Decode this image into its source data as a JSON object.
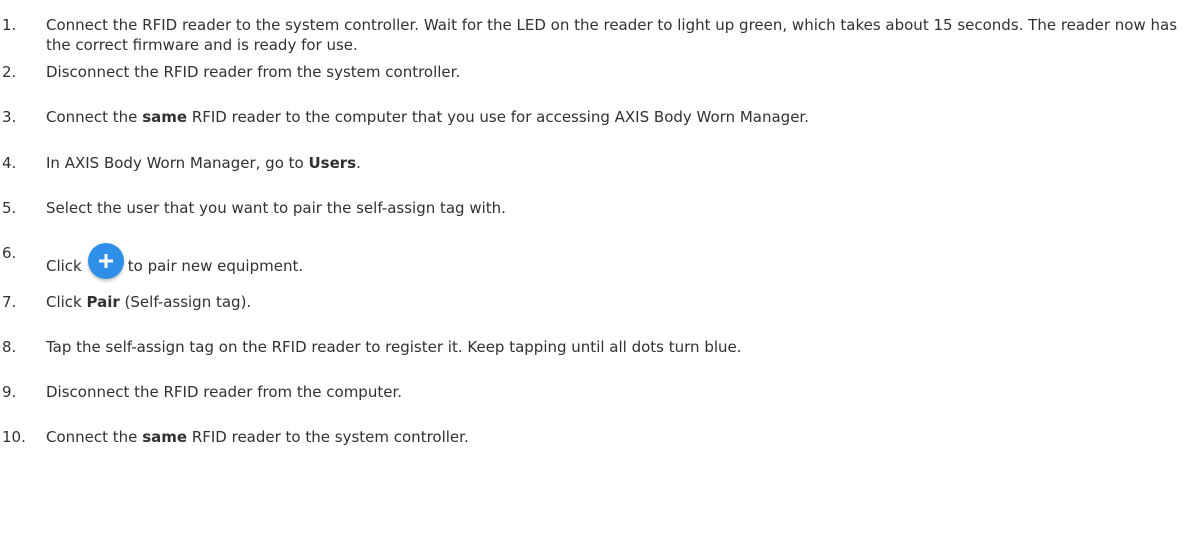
{
  "steps": [
    {
      "number": "1.",
      "parts": [
        {
          "text": "Connect the RFID reader to the system controller. Wait for the LED on the reader to light up green, which takes about 15 seconds. The reader now has the correct firmware and is ready for use."
        }
      ]
    },
    {
      "number": "2.",
      "parts": [
        {
          "text": "Disconnect the RFID reader from the system controller."
        }
      ]
    },
    {
      "number": "3.",
      "parts": [
        {
          "text": "Connect the "
        },
        {
          "text": "same",
          "bold": true
        },
        {
          "text": " RFID reader to the computer that you use for accessing AXIS Body Worn Manager."
        }
      ]
    },
    {
      "number": "4.",
      "parts": [
        {
          "text": "In AXIS Body Worn Manager, go to "
        },
        {
          "text": "Users",
          "bold": true
        },
        {
          "text": "."
        }
      ]
    },
    {
      "number": "5.",
      "parts": [
        {
          "text": "Select the user that you want to pair the self-assign tag with."
        }
      ]
    },
    {
      "number": "6.",
      "parts": [
        {
          "text": "Click"
        },
        {
          "icon": "plus-icon"
        },
        {
          "text": "to pair new equipment."
        }
      ]
    },
    {
      "number": "7.",
      "parts": [
        {
          "text": "Click "
        },
        {
          "text": "Pair",
          "bold": true
        },
        {
          "text": " (Self-assign tag)."
        }
      ]
    },
    {
      "number": "8.",
      "parts": [
        {
          "text": "Tap the self-assign tag on the RFID reader to register it. Keep tapping until all dots turn blue."
        }
      ]
    },
    {
      "number": "9.",
      "parts": [
        {
          "text": "Disconnect the RFID reader from the computer."
        }
      ]
    },
    {
      "number": "10.",
      "parts": [
        {
          "text": "Connect the "
        },
        {
          "text": "same",
          "bold": true
        },
        {
          "text": " RFID reader to the system controller."
        }
      ]
    }
  ],
  "colors": {
    "text": "#313131",
    "icon_button": "#2f8fe8",
    "icon_glyph": "#ffffff"
  }
}
